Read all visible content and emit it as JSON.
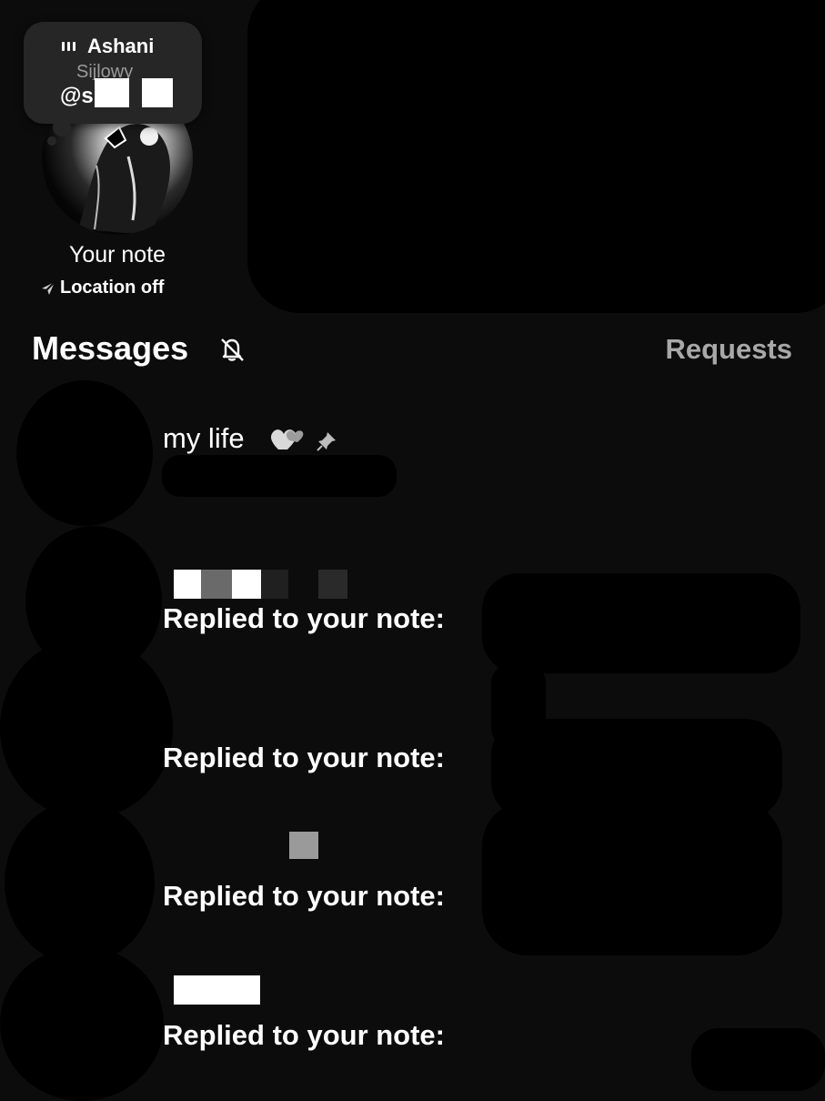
{
  "note": {
    "name": "Ashani",
    "subtitle": "Sijlowy",
    "handle": "@s"
  },
  "profile": {
    "your_note_label": "Your note",
    "location_label": "Location off"
  },
  "header": {
    "title": "Messages",
    "requests_label": "Requests"
  },
  "conversations": [
    {
      "title": "my life",
      "preview": ""
    },
    {
      "title": "",
      "preview": "Replied to your note:"
    },
    {
      "title": "",
      "preview": "Replied to your note:"
    },
    {
      "title": "",
      "preview": "Replied to your note:"
    },
    {
      "title": "",
      "preview": "Replied to your note:"
    }
  ],
  "icons": {
    "eq": "audio-bars-icon",
    "location": "location-arrow-icon",
    "bell": "bell-muted-icon",
    "heart": "heart-emoji-icon",
    "pin": "pin-icon"
  }
}
